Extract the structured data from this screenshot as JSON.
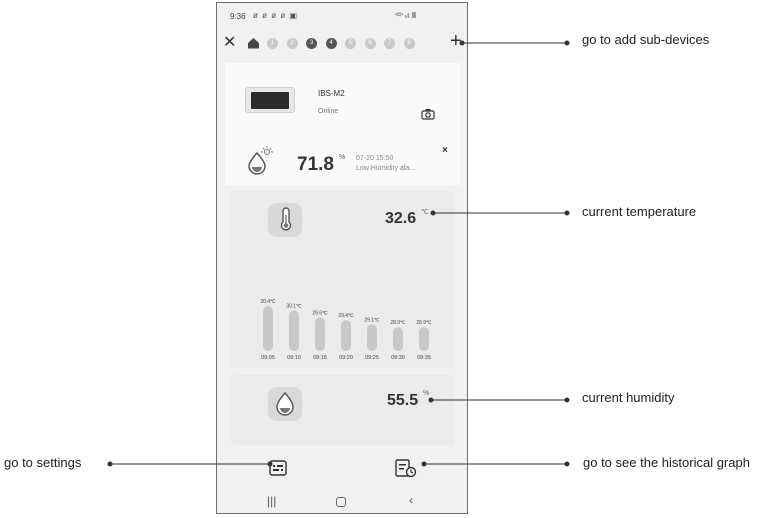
{
  "status_bar": {
    "time": "9:36",
    "notification_icons": "ø ø ø ø ▣"
  },
  "top_bar": {
    "close_icon": "close-icon",
    "home_icon": "home-icon",
    "device_dots": [
      "1",
      "2",
      "3",
      "4",
      "5",
      "6",
      "7",
      "8"
    ],
    "add_icon": "plus-icon"
  },
  "device": {
    "name": "IBS-M2",
    "status": "Online"
  },
  "alarm": {
    "value": "71.8",
    "unit": "%",
    "time": "07-20 15:50",
    "text": "Low Humidity ala...",
    "dismiss": "×"
  },
  "temperature": {
    "value": "32.6",
    "unit": "℃"
  },
  "chart_data": {
    "type": "bar",
    "categories": [
      "09:05",
      "09:10",
      "09:15",
      "09:20",
      "09:25",
      "09:30",
      "09:35"
    ],
    "values": [
      30.4,
      30.1,
      29.6,
      29.4,
      29.1,
      28.9,
      28.9
    ],
    "value_labels": [
      "30.4℃",
      "30.1℃",
      "29.6℃",
      "29.4℃",
      "29.1℃",
      "28.9℃",
      "28.9℃"
    ],
    "color": "#c8c8c8"
  },
  "humidity": {
    "value": "55.5",
    "unit": "%"
  },
  "annotations": {
    "add_sub_devices": "go to add sub-devices",
    "current_temperature": "current temperature",
    "current_humidity": "current humidity",
    "settings": "go to settings",
    "historical_graph": "go to see the historical graph"
  }
}
